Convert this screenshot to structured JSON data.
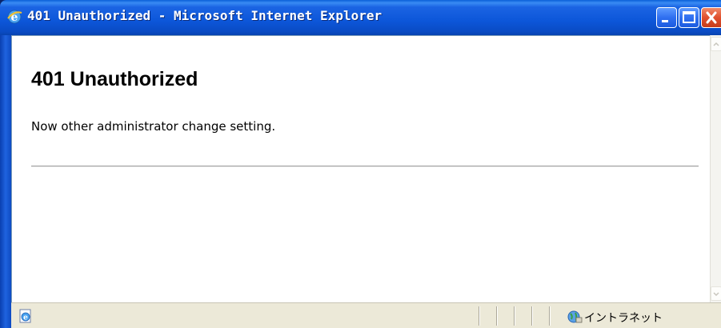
{
  "window": {
    "title": "401 Unauthorized - Microsoft Internet Explorer",
    "app_icon": "ie-icon",
    "controls": {
      "minimize_icon": "minimize-icon",
      "maximize_icon": "maximize-icon",
      "close_icon": "close-icon"
    },
    "colors": {
      "titlebar": "#0c56d9",
      "close_button": "#e0502e",
      "statusbar": "#ece9d8"
    }
  },
  "page": {
    "title": "401 Unauthorized",
    "message": "Now other administrator change setting."
  },
  "statusbar": {
    "page_icon": "ie-page-icon",
    "zone_icon": "intranet-globe-icon",
    "zone_label": "イントラネット"
  }
}
